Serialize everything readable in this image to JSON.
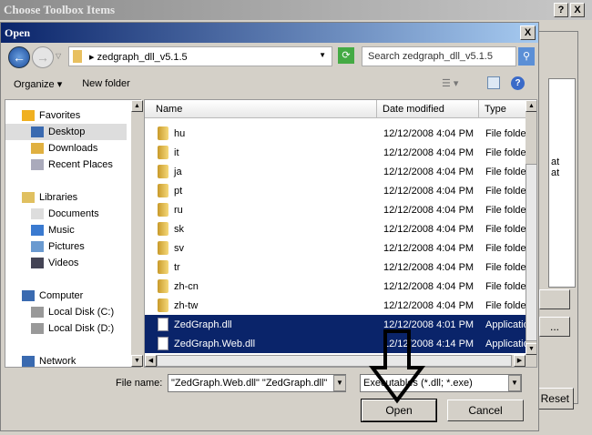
{
  "outer_dialog": {
    "title": "Choose Toolbox Items",
    "help": "?",
    "close": "X",
    "bg_text": [
      "at",
      "at"
    ],
    "reset_label": "Reset",
    "ellipsis_label": "..."
  },
  "open_dialog": {
    "title": "Open",
    "close": "X",
    "address": {
      "path": "zedgraph_dll_v5.1.5",
      "search_placeholder": "Search zedgraph_dll_v5.1.5"
    },
    "toolbar": {
      "organize": "Organize ▾",
      "new_folder": "New folder"
    },
    "nav": [
      {
        "label": "Favorites",
        "group": true,
        "icon": "star-icon"
      },
      {
        "label": "Desktop",
        "selected": true,
        "icon": "desktop-icon"
      },
      {
        "label": "Downloads",
        "icon": "downloads-icon"
      },
      {
        "label": "Recent Places",
        "icon": "recent-places-icon"
      },
      {
        "label": "Libraries",
        "group": true,
        "icon": "libraries-icon"
      },
      {
        "label": "Documents",
        "icon": "documents-icon"
      },
      {
        "label": "Music",
        "icon": "music-icon"
      },
      {
        "label": "Pictures",
        "icon": "pictures-icon"
      },
      {
        "label": "Videos",
        "icon": "videos-icon"
      },
      {
        "label": "Computer",
        "group": true,
        "icon": "computer-icon"
      },
      {
        "label": "Local Disk (C:)",
        "icon": "disk-icon"
      },
      {
        "label": "Local Disk (D:)",
        "icon": "disk-icon"
      },
      {
        "label": "Network",
        "group": true,
        "icon": "network-icon"
      }
    ],
    "columns": [
      "Name",
      "Date modified",
      "Type"
    ],
    "files": [
      {
        "name": "hu",
        "date": "12/12/2008 4:04 PM",
        "type": "File folder"
      },
      {
        "name": "it",
        "date": "12/12/2008 4:04 PM",
        "type": "File folder"
      },
      {
        "name": "ja",
        "date": "12/12/2008 4:04 PM",
        "type": "File folder"
      },
      {
        "name": "pt",
        "date": "12/12/2008 4:04 PM",
        "type": "File folder"
      },
      {
        "name": "ru",
        "date": "12/12/2008 4:04 PM",
        "type": "File folder"
      },
      {
        "name": "sk",
        "date": "12/12/2008 4:04 PM",
        "type": "File folder"
      },
      {
        "name": "sv",
        "date": "12/12/2008 4:04 PM",
        "type": "File folder"
      },
      {
        "name": "tr",
        "date": "12/12/2008 4:04 PM",
        "type": "File folder"
      },
      {
        "name": "zh-cn",
        "date": "12/12/2008 4:04 PM",
        "type": "File folder"
      },
      {
        "name": "zh-tw",
        "date": "12/12/2008 4:04 PM",
        "type": "File folder"
      },
      {
        "name": "ZedGraph.dll",
        "date": "12/12/2008 4:01 PM",
        "type": "Application extension",
        "selected": true
      },
      {
        "name": "ZedGraph.Web.dll",
        "date": "12/12/2008 4:14 PM",
        "type": "Application extension",
        "selected": true
      }
    ],
    "file_name_label": "File name:",
    "file_name_value": "\"ZedGraph.Web.dll\" \"ZedGraph.dll\"",
    "filter_value": "Executables (*.dll; *.exe)",
    "open_label": "Open",
    "cancel_label": "Cancel"
  }
}
